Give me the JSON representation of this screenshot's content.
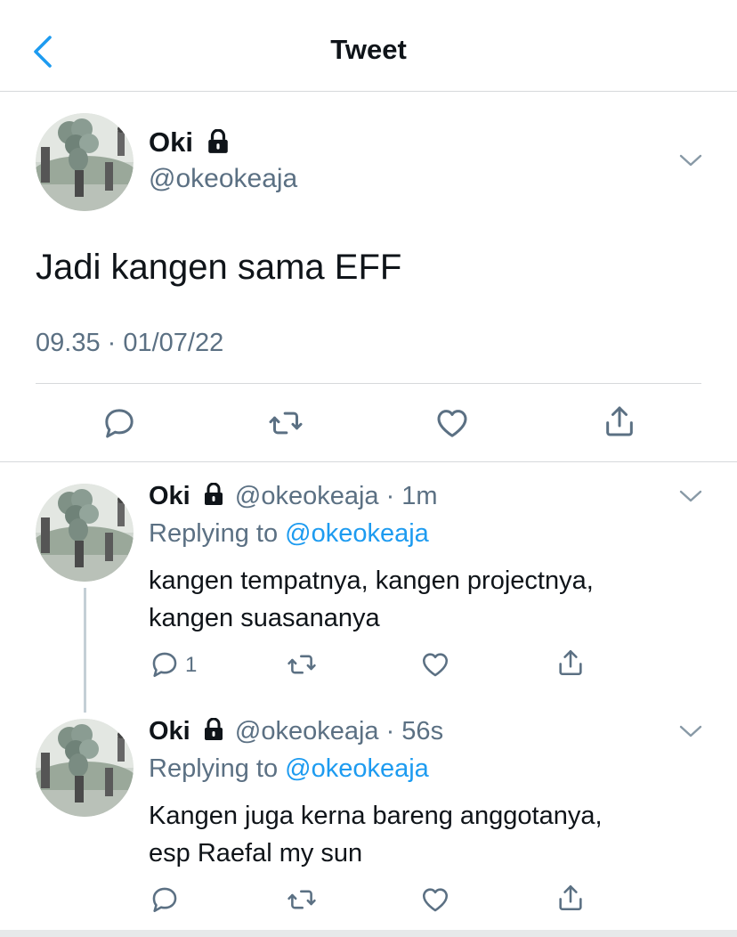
{
  "header": {
    "title": "Tweet"
  },
  "main_tweet": {
    "name": "Oki",
    "handle": "@okeokeaja",
    "text": "Jadi kangen sama EFF",
    "timestamp": "09.35 · 01/07/22"
  },
  "replies": [
    {
      "name": "Oki",
      "handle": "@okeokeaja",
      "time": "· 1m",
      "replying_prefix": "Replying to",
      "replying_to": "@okeokeaja",
      "line1": "kangen tempatnya, kangen projectnya,",
      "line2": "kangen suasananya",
      "reply_count": "1"
    },
    {
      "name": "Oki",
      "handle": "@okeokeaja",
      "time": "· 56s",
      "replying_prefix": "Replying to",
      "replying_to": "@okeokeaja",
      "line1": "Kangen juga kerna bareng anggotanya,",
      "line2": "esp Raefal my sun"
    }
  ],
  "colors": {
    "accent": "#1d9bf0",
    "muted": "#5b7083",
    "border": "#d6d9db"
  },
  "icons": [
    "back-arrow-icon",
    "lock-icon",
    "chevron-down-icon",
    "reply-icon",
    "retweet-icon",
    "like-icon",
    "share-icon"
  ]
}
